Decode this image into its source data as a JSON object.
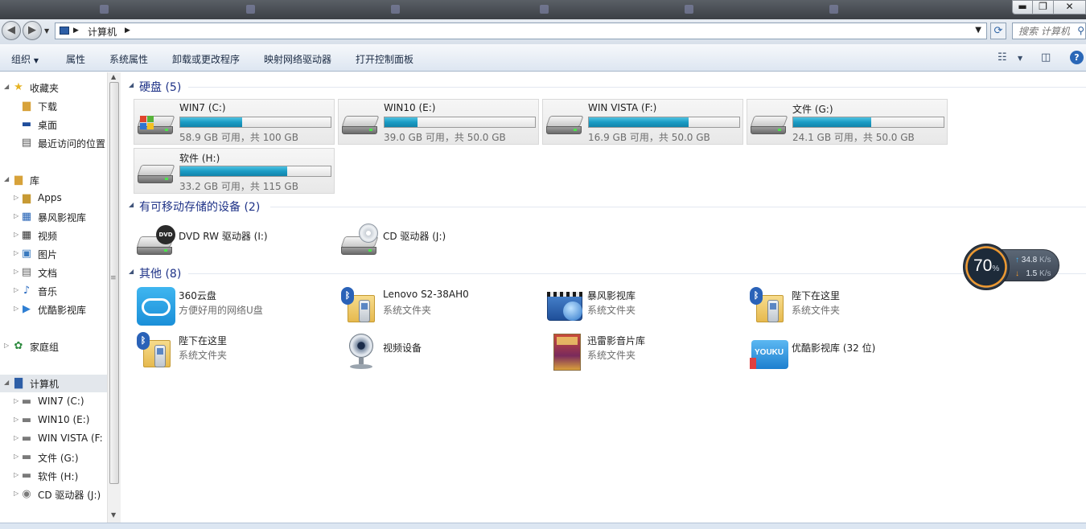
{
  "window": {
    "blurred_tabs": [
      "",
      "",
      "",
      "",
      "",
      "",
      ""
    ],
    "controls": {
      "minimize": "▬",
      "maximize": "❐",
      "close": "✕"
    }
  },
  "address": {
    "path": "计算机",
    "search_placeholder": "搜索 计算机"
  },
  "toolbar": {
    "organize": "组织",
    "properties": "属性",
    "system_properties": "系统属性",
    "uninstall": "卸载或更改程序",
    "map_drive": "映射网络驱动器",
    "control_panel": "打开控制面板"
  },
  "sidebar": {
    "favorites": "收藏夹",
    "downloads": "下载",
    "desktop": "桌面",
    "recent": "最近访问的位置",
    "libraries": "库",
    "apps": "Apps",
    "baofeng": "暴风影视库",
    "videos": "视频",
    "pictures": "图片",
    "documents": "文档",
    "music": "音乐",
    "youku": "优酷影视库",
    "homegroup": "家庭组",
    "computer": "计算机",
    "d_c": "WIN7 (C:)",
    "d_e": "WIN10 (E:)",
    "d_f": "WIN  VISTA (F:",
    "d_g": "文件 (G:)",
    "d_h": "软件 (H:)",
    "d_j": "CD 驱动器 (J:)"
  },
  "sections": {
    "hdd": "硬盘 (5)",
    "removable": "有可移动存储的设备 (2)",
    "other": "其他 (8)"
  },
  "drives": [
    {
      "name": "WIN7 (C:)",
      "free": "58.9 GB 可用，共 100 GB",
      "used_fraction": 0.41
    },
    {
      "name": "WIN10 (E:)",
      "free": "39.0 GB 可用，共 50.0 GB",
      "used_fraction": 0.22
    },
    {
      "name": "WIN  VISTA (F:)",
      "free": "16.9 GB 可用，共 50.0 GB",
      "used_fraction": 0.662
    },
    {
      "name": "文件 (G:)",
      "free": "24.1 GB 可用，共 50.0 GB",
      "used_fraction": 0.518
    },
    {
      "name": "软件 (H:)",
      "free": "33.2 GB 可用，共 115 GB",
      "used_fraction": 0.711
    }
  ],
  "removable": {
    "dvd": "DVD RW 驱动器 (I:)",
    "cd": "CD 驱动器 (J:)",
    "dvd_badge": "DVD"
  },
  "other": {
    "cloud": {
      "name": "360云盘",
      "sub": "方便好用的网络U盘"
    },
    "lenovo": {
      "name": "Lenovo S2-38AH0",
      "sub": "系统文件夹"
    },
    "baofeng": {
      "name": "暴风影视库",
      "sub": "系统文件夹"
    },
    "bt1": {
      "name": "陛下在这里",
      "sub": "系统文件夹"
    },
    "bt2": {
      "name": "陛下在这里",
      "sub": "系统文件夹"
    },
    "camera": {
      "name": "视频设备"
    },
    "xunlei": {
      "name": "迅雷影音片库",
      "sub": "系统文件夹"
    },
    "youku": {
      "name": "优酷影视库 (32 位)",
      "badge": "YOUKU"
    }
  },
  "speed_widget": {
    "percent": "70",
    "percent_sign": "%",
    "up": "34.8",
    "down": "1.5",
    "unit": "K/s"
  }
}
